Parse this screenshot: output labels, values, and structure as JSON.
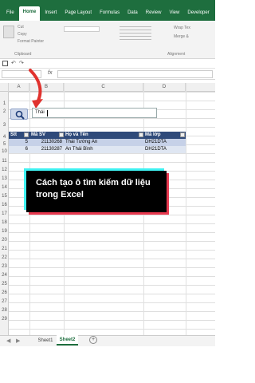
{
  "ribbon": {
    "tabs": [
      "File",
      "Home",
      "Insert",
      "Page Layout",
      "Formulas",
      "Data",
      "Review",
      "View",
      "Developer",
      "He"
    ],
    "active_tab": "Home",
    "clipboard": {
      "cut": "Cut",
      "copy": "Copy",
      "format_painter": "Format Painter",
      "group": "Clipboard"
    },
    "alignment": {
      "wrap_text": "Wrap Tex",
      "merge": "Merge &",
      "group": "Alignment"
    }
  },
  "formula_bar": {
    "fx": "fx"
  },
  "columns": [
    "A",
    "B",
    "C",
    "D"
  ],
  "rows": [
    "1",
    "2",
    "3",
    "4",
    "5",
    "10",
    "11",
    "12",
    "13",
    "14",
    "15",
    "16",
    "17",
    "18",
    "19",
    "20",
    "21",
    "22",
    "23",
    "24",
    "25",
    "26",
    "27",
    "28",
    "29"
  ],
  "search": {
    "value": "Thái"
  },
  "table": {
    "headers": [
      "Stt",
      "Mã SV",
      "Họ và Tên",
      "Mã lớp"
    ],
    "rows": [
      [
        "5",
        "21130268",
        "Thái Tường An",
        "DH21DTA"
      ],
      [
        "6",
        "21130287",
        "An Thái Bình",
        "DH21DTA"
      ]
    ]
  },
  "overlay": {
    "text": "Cách tạo ô tìm kiếm dữ liệu trong Excel"
  },
  "sheets": {
    "sheet1": "Sheet1",
    "sheet2": "Sheet2",
    "add": "+"
  },
  "colors": {
    "accent": "#1e6e3e",
    "arrow": "#e0322e"
  }
}
